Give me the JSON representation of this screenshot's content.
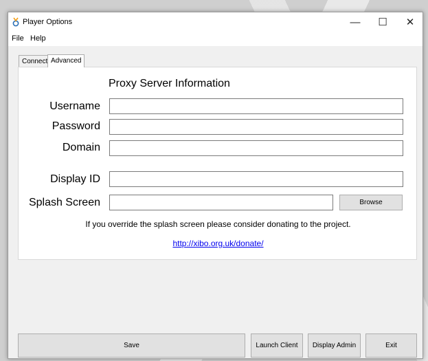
{
  "window": {
    "title": "Player Options",
    "minimize_glyph": "—",
    "maximize_glyph": "☐",
    "close_glyph": "✕"
  },
  "menu": {
    "file": "File",
    "help": "Help"
  },
  "tabs": [
    {
      "label": "Connect",
      "active": false
    },
    {
      "label": "Advanced",
      "active": true
    }
  ],
  "advanced": {
    "section_title": "Proxy Server Information",
    "username_label": "Username",
    "username_value": "",
    "password_label": "Password",
    "password_value": "",
    "domain_label": "Domain",
    "domain_value": "",
    "display_id_label": "Display ID",
    "display_id_value": "",
    "splash_label": "Splash Screen",
    "splash_value": "",
    "browse_label": "Browse",
    "note": "If you override the splash screen please consider donating to the project.",
    "donate_link": "http://xibo.org.uk/donate/"
  },
  "buttons": {
    "save": "Save",
    "launch_client": "Launch Client",
    "display_admin": "Display Admin",
    "exit": "Exit"
  },
  "colors": {
    "link": "#0000ee",
    "window_bg": "#f0f0f0",
    "panel_bg": "#ffffff"
  },
  "icons": {
    "app": "xibo-app-icon",
    "minimize": "minimize-icon",
    "maximize": "maximize-icon",
    "close": "close-icon"
  }
}
